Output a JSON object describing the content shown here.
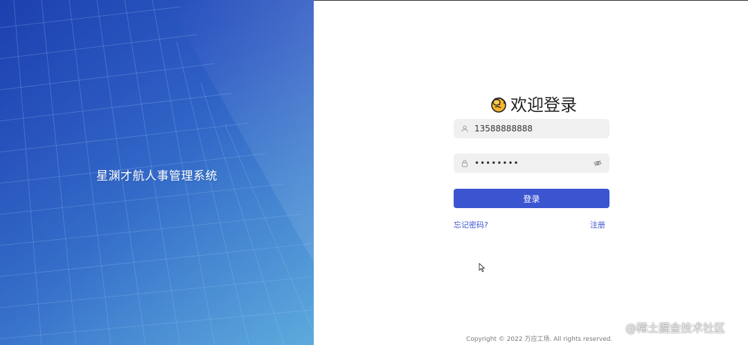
{
  "hero": {
    "system_name": "星渊才航人事管理系统"
  },
  "login": {
    "title": "欢迎登录",
    "username": {
      "value": "13588888888"
    },
    "password": {
      "value": "••••••••"
    },
    "submit_label": "登录",
    "forgot_label": "忘记密码?",
    "register_label": "注册"
  },
  "footer": {
    "copyright": "Copyright © 2022 万应工场. All rights reserved."
  },
  "watermark": "@稀土掘金技术社区",
  "colors": {
    "accent": "#3b55d1",
    "hero_start": "#1f44b5",
    "hero_end": "#5aa6db",
    "field_bg": "#f0f0f0"
  },
  "icons": {
    "title_icon": "clapping-hands-icon",
    "username_icon": "user-icon",
    "password_icon": "lock-icon",
    "password_toggle": "eye-off-icon"
  }
}
